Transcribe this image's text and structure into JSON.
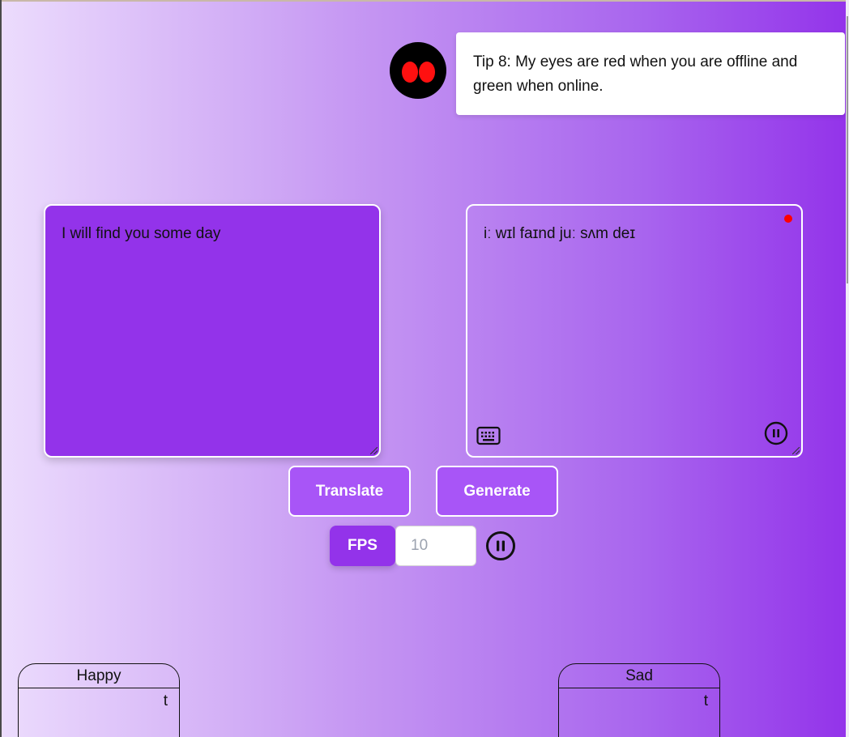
{
  "tip": {
    "text": "Tip 8: My eyes are red when you are offline and green when online."
  },
  "robot": {
    "eye_color": "#ff1010",
    "status": "offline"
  },
  "input_box": {
    "text": "I will find you some day"
  },
  "output_box": {
    "text": "iː wɪl faɪnd juː sʌm deɪ",
    "recording_dot_color": "#ff0000",
    "left_icon": "keyboard-icon",
    "right_icon": "pause-icon"
  },
  "buttons": {
    "translate": "Translate",
    "generate": "Generate"
  },
  "fps": {
    "label": "FPS",
    "placeholder": "10"
  },
  "emotions": [
    {
      "title": "Happy",
      "value": "t"
    },
    {
      "title": "Sad",
      "value": "t"
    }
  ],
  "colors": {
    "accent": "#9333ea",
    "button": "#a855f7",
    "gradient_start": "#ecdcfd",
    "gradient_end": "#9333ea"
  }
}
